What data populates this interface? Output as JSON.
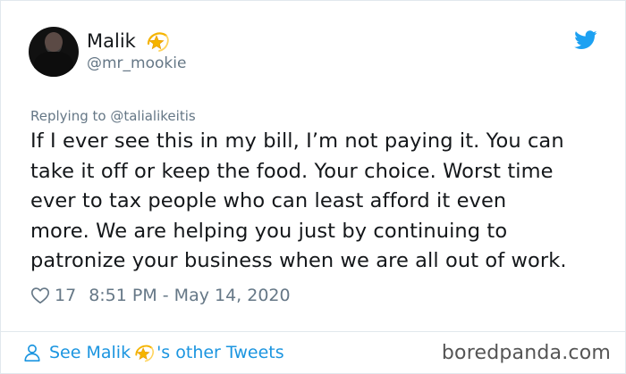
{
  "author": {
    "name": "Malik",
    "handle": "@mr_mookie"
  },
  "reply_to": "Replying to @talialikeitis",
  "tweet": {
    "lines": [
      "If I ever see this in my bill, I’m not paying it. You can",
      "take it off or keep the food. Your choice. Worst time",
      "ever to tax people who can least afford it even",
      "more. We are helping you just by continuing to",
      "patronize your business when we are all out of work."
    ],
    "likes": "17",
    "timestamp": "8:51 PM - May 14, 2020"
  },
  "footer": {
    "see_prefix": "See Malik",
    "see_suffix": "'s other Tweets",
    "watermark": "boredpanda.com"
  },
  "icons": {
    "star": "dizzy-star-icon",
    "bird": "twitter-bird-icon",
    "heart": "heart-outline-icon",
    "person": "person-outline-icon"
  },
  "colors": {
    "twitter_blue": "#1da1f2",
    "link_blue": "#1b95e0",
    "secondary_text": "#657786",
    "star_gold": "#f5b400"
  }
}
